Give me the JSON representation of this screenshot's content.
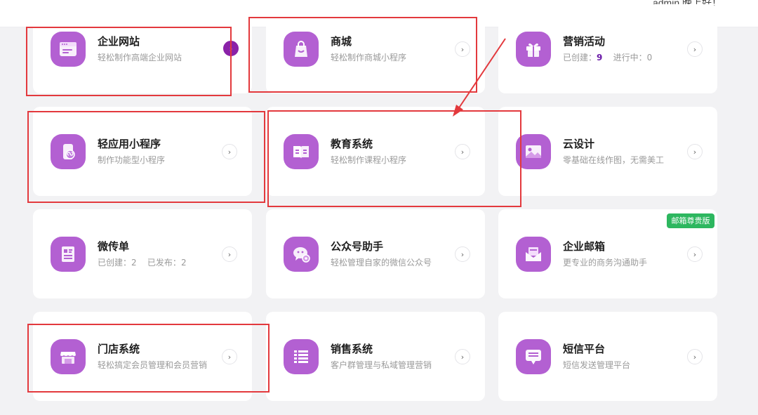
{
  "header": {
    "greeting": "admin,晚上好！"
  },
  "cards": [
    {
      "title": "企业网站",
      "subtitle": "轻松制作高端企业网站",
      "icon": "browser-window-icon"
    },
    {
      "title": "商城",
      "subtitle": "轻松制作商城小程序",
      "icon": "shopping-bag-icon"
    },
    {
      "title": "营销活动",
      "created_label": "已创建：",
      "created_value": "9",
      "running_label": "进行中：",
      "running_value": "0",
      "icon": "gift-icon"
    },
    {
      "title": "轻应用小程序",
      "subtitle": "制作功能型小程序",
      "icon": "mini-program-icon"
    },
    {
      "title": "教育系统",
      "subtitle": "轻松制作课程小程序",
      "icon": "open-book-icon"
    },
    {
      "title": "云设计",
      "subtitle": "零基础在线作图，无需美工",
      "icon": "image-icon"
    },
    {
      "title": "微传单",
      "created_label": "已创建：",
      "created_value": "2",
      "published_label": "已发布：",
      "published_value": "2",
      "icon": "flyer-icon"
    },
    {
      "title": "公众号助手",
      "subtitle": "轻松管理自家的微信公众号",
      "icon": "wechat-gear-icon"
    },
    {
      "title": "企业邮箱",
      "subtitle": "更专业的商务沟通助手",
      "badge": "邮箱尊贵版",
      "icon": "mail-icon"
    },
    {
      "title": "门店系统",
      "subtitle": "轻松搞定会员管理和会员营销",
      "icon": "storefront-icon"
    },
    {
      "title": "销售系统",
      "subtitle": "客户群管理与私域管理营销",
      "icon": "list-icon"
    },
    {
      "title": "短信平台",
      "subtitle": "短信发送管理平台",
      "icon": "sms-icon"
    }
  ],
  "colors": {
    "icon_bg": "#b360d2",
    "annotation": "#e3393d",
    "badge": "#2db75f",
    "accent": "#8a22a8"
  }
}
